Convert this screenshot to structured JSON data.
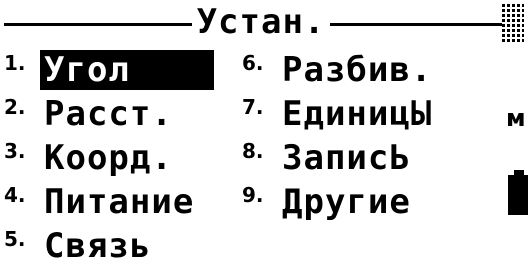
{
  "header": {
    "title": "Устан."
  },
  "menu": {
    "items": [
      {
        "number": "1.",
        "label": "Угол",
        "selected": true
      },
      {
        "number": "2.",
        "label": "Расст."
      },
      {
        "number": "3.",
        "label": "Коорд."
      },
      {
        "number": "4.",
        "label": "Питание"
      },
      {
        "number": "5.",
        "label": "Связь"
      },
      {
        "number": "6.",
        "label": "Разбив."
      },
      {
        "number": "7.",
        "label": "ЕдиницЫ"
      },
      {
        "number": "8.",
        "label": "ЗаписЬ"
      },
      {
        "number": "9.",
        "label": "Другие"
      }
    ]
  },
  "status": {
    "mode_text": "ᴍ",
    "battery_icon": "battery-full-icon",
    "scroll_icon": "scroll-bar-icon"
  },
  "colors": {
    "background": "#ffffff",
    "foreground": "#000000",
    "selection_bg": "#000000",
    "selection_fg": "#ffffff"
  }
}
